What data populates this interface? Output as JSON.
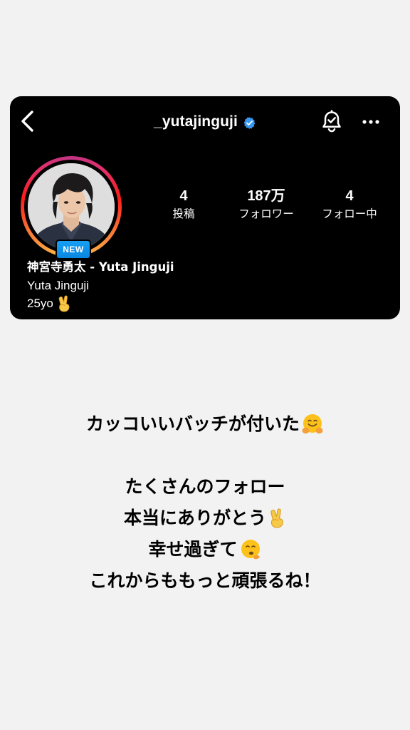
{
  "header": {
    "username": "_yutajinguji",
    "verified_color": "#3897f0"
  },
  "icons": {
    "back": "chevron-left-icon",
    "verified": "verified-badge-icon",
    "notification": "bell-check-icon",
    "more": "more-horizontal-icon",
    "peace": "victory-hand-emoji",
    "hug": "hugging-face-emoji",
    "melt": "face-holding-back-tears-emoji"
  },
  "profile": {
    "badge": "NEW",
    "display_name": "神宮寺勇太 - Yuta Jinguji",
    "bio_line1": "Yuta Jinguji",
    "bio_line2": "25yo",
    "stats": [
      {
        "value": "4",
        "label": "投稿"
      },
      {
        "value": "187万",
        "label": "フォロワー"
      },
      {
        "value": "4",
        "label": "フォロー中"
      }
    ]
  },
  "message": {
    "line1": "カッコいいバッチが付いた",
    "line2": "たくさんのフォロー",
    "line3": "本当にありがとう",
    "line4": "幸せ過ぎて",
    "line5": "これからももっと頑張るね！"
  },
  "colors": {
    "card_bg": "#000000",
    "page_bg": "#f2f2f2",
    "badge_blue": "#1a9bf0"
  }
}
